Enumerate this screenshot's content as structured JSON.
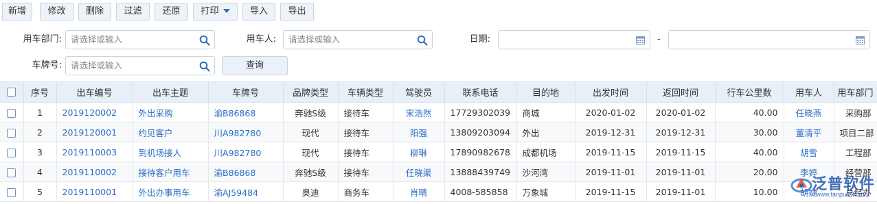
{
  "toolbar": {
    "buttons": [
      {
        "label": "新增"
      },
      {
        "label": "修改"
      },
      {
        "label": "删除"
      },
      {
        "label": "过滤"
      },
      {
        "label": "还原"
      },
      {
        "label": "打印"
      },
      {
        "label": "导入"
      },
      {
        "label": "导出"
      }
    ]
  },
  "filters": {
    "dept_label": "用车部门:",
    "dept_placeholder": "请选择或输入",
    "user_label": "用车人:",
    "user_placeholder": "请选择或输入",
    "date_label": "日期:",
    "date_separator": "-",
    "plate_label": "车牌号:",
    "plate_placeholder": "请选择或输入",
    "query_label": "查询"
  },
  "table": {
    "headers": [
      "序号",
      "出车编号",
      "出车主题",
      "车牌号",
      "品牌类型",
      "车辆类型",
      "驾驶员",
      "联系电话",
      "目的地",
      "出发时间",
      "返回时间",
      "行车公里数",
      "用车人",
      "用车部门"
    ],
    "rows": [
      [
        "1",
        "2019120002",
        "外出采购",
        "渝B86868",
        "奔驰S级",
        "接待车",
        "宋浩然",
        "17729302039",
        "商城",
        "2020-01-02",
        "2020-01-02",
        "40.00",
        "任晓燕",
        "采购部"
      ],
      [
        "2",
        "2019120001",
        "约见客户",
        "川A982780",
        "现代",
        "接待车",
        "阳强",
        "13809203094",
        "外出",
        "2019-12-31",
        "2019-12-31",
        "30.00",
        "董清平",
        "项目二部"
      ],
      [
        "3",
        "2019110003",
        "到机场接人",
        "川A982780",
        "现代",
        "接待车",
        "柳琳",
        "17890982678",
        "成都机场",
        "2019-11-15",
        "2019-11-15",
        "40.00",
        "胡雪",
        "工程部"
      ],
      [
        "4",
        "2019110002",
        "接待客户用车",
        "渝B86868",
        "奔驰S级",
        "接待车",
        "任晓渠",
        "13888439749",
        "沙河湾",
        "2019-11-01",
        "2019-11-01",
        "20.00",
        "李婷",
        "经营部"
      ],
      [
        "5",
        "2019110001",
        "外出办事用车",
        "渝AJ59484",
        "奥迪",
        "商务车",
        "肖晴",
        "4008-585858",
        "万象城",
        "2019-11-15",
        "2019-11-01",
        "10.00",
        "胡婕",
        "总经办"
      ]
    ]
  },
  "watermark": {
    "brand": "泛普软件",
    "url": "www.fanpusoft.com"
  },
  "colors": {
    "link": "#2a6cc4",
    "header_bg": "#e7eff8",
    "button_bg": "#eef3f9"
  }
}
